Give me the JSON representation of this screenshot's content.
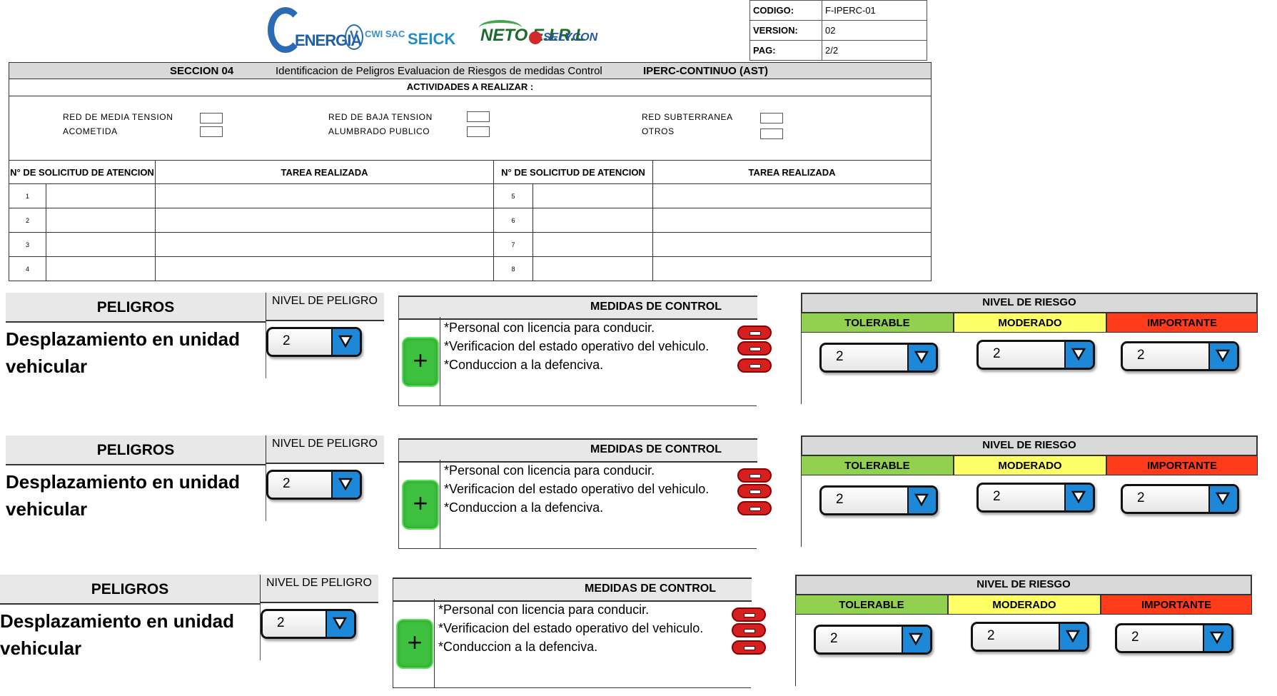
{
  "header": {
    "logos": [
      "ENERGIA",
      "CWI SAC",
      "SEICK",
      "NETO E.I.R.L",
      "SELYCON"
    ],
    "meta": [
      {
        "label": "CODIGO:",
        "value": "F-IPERC-01"
      },
      {
        "label": "VERSION:",
        "value": "02"
      },
      {
        "label": "PAG:",
        "value": "2/2"
      }
    ],
    "section": "SECCION 04",
    "section_title": "Identificacion de Peligros Evaluacion de Riesgos de medidas Control",
    "section_code": "IPERC-CONTINUO (AST)",
    "activities_title": "ACTIVIDADES  A REALIZAR :",
    "activities": [
      "RED DE MEDIA TENSION",
      "RED DE BAJA TENSION",
      "RED SUBTERRANEA",
      "ACOMETIDA",
      "ALUMBRADO PUBLICO",
      "OTROS"
    ],
    "col_solicitud": "N° DE  SOLICITUD DE ATENCION",
    "col_tarea": "TAREA REALIZADA",
    "rows_left": [
      "1",
      "2",
      "3",
      "4"
    ],
    "rows_right": [
      "5",
      "6",
      "7",
      "8"
    ]
  },
  "blocks": [
    {
      "peligros_label": "PELIGROS",
      "nivel_label": "NIVEL DE PELIGRO",
      "peligro": "Desplazamiento en unidad vehicular",
      "nivel_value": "2",
      "medidas_label": "MEDIDAS DE CONTROL",
      "medidas": [
        "*Personal con licencia  para conducir.",
        "*Verificacion del estado operativo del vehiculo.",
        "*Conduccion a la defenciva."
      ],
      "plus_label": "+",
      "riesgo_label": "NIVEL DE RIESGO",
      "levels": [
        {
          "name": "TOLERABLE",
          "value": "2"
        },
        {
          "name": "MODERADO",
          "value": "2"
        },
        {
          "name": "IMPORTANTE",
          "value": "2"
        }
      ]
    },
    {
      "peligros_label": "PELIGROS",
      "nivel_label": "NIVEL DE PELIGRO",
      "peligro": "Desplazamiento en unidad vehicular",
      "nivel_value": "2",
      "medidas_label": "MEDIDAS DE CONTROL",
      "medidas": [
        "*Personal con licencia  para conducir.",
        "*Verificacion del estado operativo del vehiculo.",
        "*Conduccion a la defenciva."
      ],
      "plus_label": "+",
      "riesgo_label": "NIVEL DE RIESGO",
      "levels": [
        {
          "name": "TOLERABLE",
          "value": "2"
        },
        {
          "name": "MODERADO",
          "value": "2"
        },
        {
          "name": "IMPORTANTE",
          "value": "2"
        }
      ]
    },
    {
      "peligros_label": "PELIGROS",
      "nivel_label": "NIVEL DE PELIGRO",
      "peligro": "Desplazamiento en unidad vehicular",
      "nivel_value": "2",
      "medidas_label": "MEDIDAS DE CONTROL",
      "medidas": [
        "*Personal con licencia  para conducir.",
        "*Verificacion del estado operativo del vehiculo.",
        "*Conduccion a la defenciva."
      ],
      "plus_label": "+",
      "riesgo_label": "NIVEL DE RIESGO",
      "levels": [
        {
          "name": "TOLERABLE",
          "value": "2"
        },
        {
          "name": "MODERADO",
          "value": "2"
        },
        {
          "name": "IMPORTANTE",
          "value": "2"
        }
      ]
    }
  ],
  "colors": {
    "tolerable": "#92d050",
    "moderado": "#ffff66",
    "importante": "#ff3b1a",
    "dropdown_button": "#1e88d8",
    "add_button": "#3ec13e",
    "remove_button": "#d62020"
  },
  "icons": {
    "dropdown": "triangle-down-icon",
    "add": "plus-icon",
    "remove": "minus-icon"
  }
}
